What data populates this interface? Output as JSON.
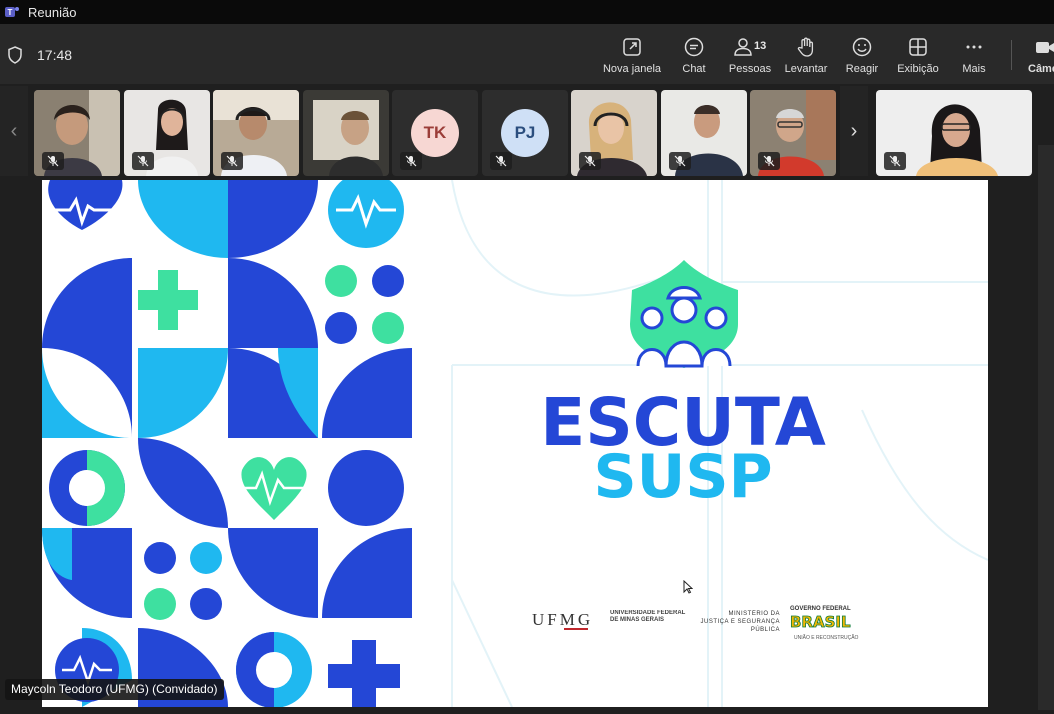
{
  "window": {
    "title": "Reunião"
  },
  "meeting": {
    "time": "17:48"
  },
  "toolbar": {
    "nova_janela": "Nova janela",
    "chat": "Chat",
    "pessoas": "Pessoas",
    "pessoas_count": "13",
    "levantar": "Levantar",
    "reagir": "Reagir",
    "exibicao": "Exibição",
    "mais": "Mais",
    "camera": "Câme"
  },
  "participants": {
    "tk_initials": "TK",
    "pj_initials": "PJ"
  },
  "slide": {
    "title_line1": "ESCUTA",
    "title_line2": "SUSP",
    "ufmg_logo": "UFMG",
    "ufmg_name": "UNIVERSIDADE FEDERAL DE MINAS GERAIS",
    "ministerio": "MINISTÉRIO DA JUSTIÇA E SEGURANÇA PÚBLICA",
    "governo": "GOVERNO FEDERAL",
    "brasil": "BRASIL",
    "uniao": "UNIÃO E RECONSTRUÇÃO"
  },
  "presenter": {
    "name": "Maycoln Teodoro (UFMG) (Convidado)"
  },
  "colors": {
    "blue": "#2447d6",
    "cyan": "#1fb8f0",
    "mint": "#3ee0a0",
    "accent": "#7f85f5"
  }
}
